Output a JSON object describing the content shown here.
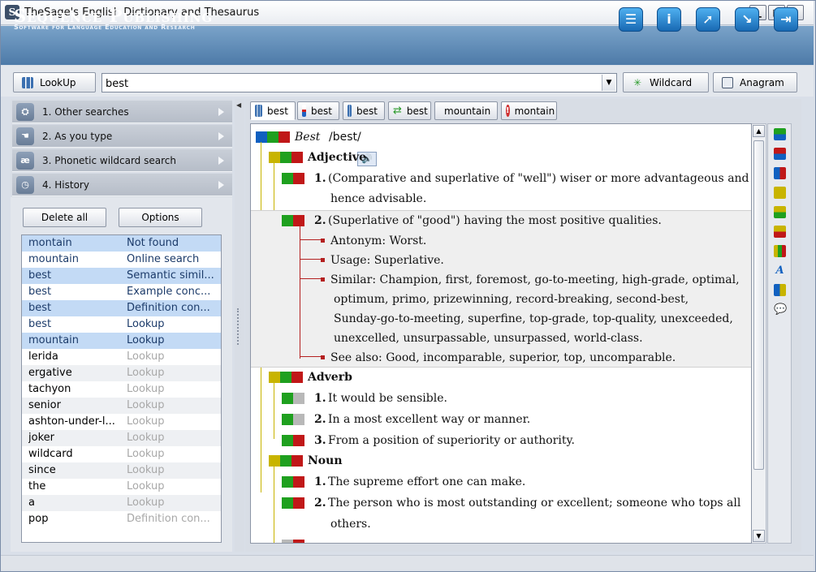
{
  "window": {
    "title": "TheSage's English Dictionary and Thesaurus"
  },
  "banner": {
    "brand": "Sequence Publishing",
    "tagline": "Software for Language Education and Research",
    "tool_icons": [
      "list-icon",
      "info-icon",
      "walk-icon",
      "pointer-icon",
      "exit-icon"
    ]
  },
  "toolbar": {
    "lookup_label": "LookUp",
    "search_value": "best",
    "wildcard_label": "Wildcard",
    "anagram_label": "Anagram"
  },
  "accordion": [
    {
      "label": "1. Other searches",
      "icon": "binoculars-icon"
    },
    {
      "label": "2. As you type",
      "icon": "hand-icon"
    },
    {
      "label": "3. Phonetic wildcard search",
      "icon": "phonetic-icon"
    },
    {
      "label": "4. History",
      "icon": "clock-icon"
    }
  ],
  "history": {
    "delete_all_label": "Delete all",
    "options_label": "Options",
    "rows": [
      {
        "word": "montain",
        "source": "Not found"
      },
      {
        "word": "mountain",
        "source": "Online search"
      },
      {
        "word": "best",
        "source": "Semantic simil..."
      },
      {
        "word": "best",
        "source": "Example conc..."
      },
      {
        "word": "best",
        "source": "Definition con..."
      },
      {
        "word": "best",
        "source": "Lookup"
      },
      {
        "word": "mountain",
        "source": "Lookup"
      },
      {
        "word": "lerida",
        "source": "Lookup"
      },
      {
        "word": "ergative",
        "source": "Lookup"
      },
      {
        "word": "tachyon",
        "source": "Lookup"
      },
      {
        "word": "senior",
        "source": "Lookup"
      },
      {
        "word": "ashton-under-l...",
        "source": "Lookup"
      },
      {
        "word": "joker",
        "source": "Lookup"
      },
      {
        "word": "wildcard",
        "source": "Lookup"
      },
      {
        "word": "since",
        "source": "Lookup"
      },
      {
        "word": "the",
        "source": "Lookup"
      },
      {
        "word": "a",
        "source": "Lookup"
      },
      {
        "word": "pop",
        "source": "Definition con..."
      }
    ]
  },
  "tabs": [
    {
      "label": "best",
      "icon": "book-icon"
    },
    {
      "label": "best",
      "icon": "chart-icon"
    },
    {
      "label": "best",
      "icon": "columns-icon"
    },
    {
      "label": "best",
      "icon": "arrows-icon"
    },
    {
      "label": "mountain",
      "icon": "globe-icon"
    },
    {
      "label": "montain",
      "icon": "error-icon"
    }
  ],
  "entry": {
    "headword": "Best",
    "pronunciation": "/best/",
    "sections": [
      {
        "pos": "Adjective"
      },
      {
        "pos": "Adverb"
      },
      {
        "pos": "Noun"
      }
    ],
    "adj_senses": [
      {
        "num": "1.",
        "text_l1": "(Comparative and superlative of \"well\") wiser or more advantageous and",
        "text_l2": "hence advisable."
      },
      {
        "num": "2.",
        "text_l1": "(Superlative of \"good\") having the most positive qualities."
      }
    ],
    "adj_details": {
      "antonym": "Antonym: Worst.",
      "usage": "Usage: Superlative.",
      "similar_l1": "Similar: Champion, first, foremost, go-to-meeting, high-grade, optimal,",
      "similar_l2": "optimum, primo, prizewinning, record-breaking, second-best,",
      "similar_l3": "Sunday-go-to-meeting, superfine, top-grade, top-quality, unexceeded,",
      "similar_l4": "unexcelled, unsurpassable, unsurpassed, world-class.",
      "see_also": "See also: Good, incomparable, superior, top, uncomparable."
    },
    "adv_senses": [
      {
        "num": "1.",
        "text": "It would be sensible."
      },
      {
        "num": "2.",
        "text": "In a most excellent way or manner."
      },
      {
        "num": "3.",
        "text": "From a position of superiority or authority."
      }
    ],
    "noun_senses": [
      {
        "num": "1.",
        "text": "The supreme effort one can make."
      },
      {
        "num": "2.",
        "text_l1": "The person who is most outstanding or excellent; someone who tops all",
        "text_l2": "others."
      }
    ]
  },
  "colors": {
    "accent": "#4d7aa8",
    "selection": "#c3daf5",
    "green": "#1fa01f",
    "red": "#c01818",
    "olive": "#c8b400",
    "blue": "#1060c0"
  }
}
